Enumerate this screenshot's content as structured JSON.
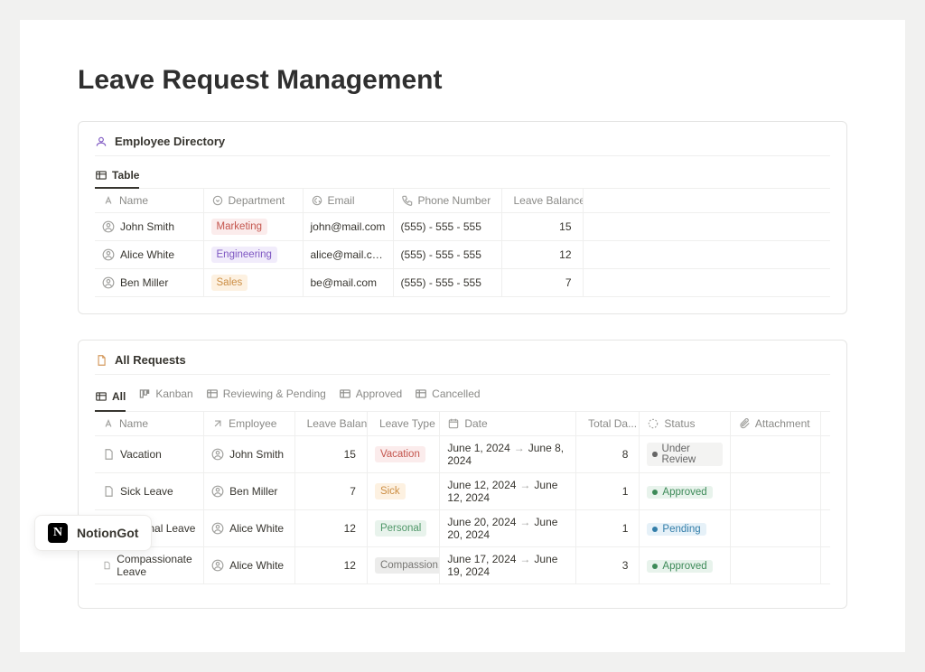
{
  "page": {
    "title": "Leave Request Management"
  },
  "emp_section": {
    "title": "Employee Directory",
    "view_tab": "Table",
    "columns": {
      "name": "Name",
      "department": "Department",
      "email": "Email",
      "phone": "Phone Number",
      "balance": "Leave Balance"
    },
    "rows": [
      {
        "name": "John Smith",
        "department": "Marketing",
        "dept_tag": "red",
        "email": "john@mail.com",
        "phone": "(555) - 555 - 555",
        "balance": "15"
      },
      {
        "name": "Alice White",
        "department": "Engineering",
        "dept_tag": "purple",
        "email": "alice@mail.com",
        "phone": "(555) - 555 - 555",
        "balance": "12"
      },
      {
        "name": "Ben Miller",
        "department": "Sales",
        "dept_tag": "orange",
        "email": "be@mail.com",
        "phone": "(555) - 555 - 555",
        "balance": "7"
      }
    ]
  },
  "req_section": {
    "title": "All Requests",
    "tabs": [
      {
        "label": "All"
      },
      {
        "label": "Kanban"
      },
      {
        "label": "Reviewing & Pending"
      },
      {
        "label": "Approved"
      },
      {
        "label": "Cancelled"
      }
    ],
    "columns": {
      "name": "Name",
      "employee": "Employee",
      "balance": "Leave Balan...",
      "type": "Leave Type",
      "date": "Date",
      "days": "Total Da...",
      "status": "Status",
      "attachment": "Attachment"
    },
    "rows": [
      {
        "name": "Vacation",
        "employee": "John Smith",
        "balance": "15",
        "type": "Vacation",
        "type_tag": "red",
        "date_from": "June 1, 2024",
        "date_to": "June 8, 2024",
        "days": "8",
        "status": "Under Review",
        "status_style": "grey"
      },
      {
        "name": "Sick Leave",
        "employee": "Ben Miller",
        "balance": "7",
        "type": "Sick",
        "type_tag": "orange",
        "date_from": "June 12, 2024",
        "date_to": "June 12, 2024",
        "days": "1",
        "status": "Approved",
        "status_style": "green"
      },
      {
        "name": "Personal Leave",
        "employee": "Alice White",
        "balance": "12",
        "type": "Personal",
        "type_tag": "green",
        "date_from": "June 20, 2024",
        "date_to": "June 20, 2024",
        "days": "1",
        "status": "Pending",
        "status_style": "blue"
      },
      {
        "name": "Compassionate Leave",
        "employee": "Alice White",
        "balance": "12",
        "type": "Compassion...",
        "type_tag": "grey",
        "date_from": "June 17, 2024",
        "date_to": "June 19, 2024",
        "days": "3",
        "status": "Approved",
        "status_style": "green"
      }
    ]
  },
  "logo": {
    "text": "NotionGot"
  }
}
